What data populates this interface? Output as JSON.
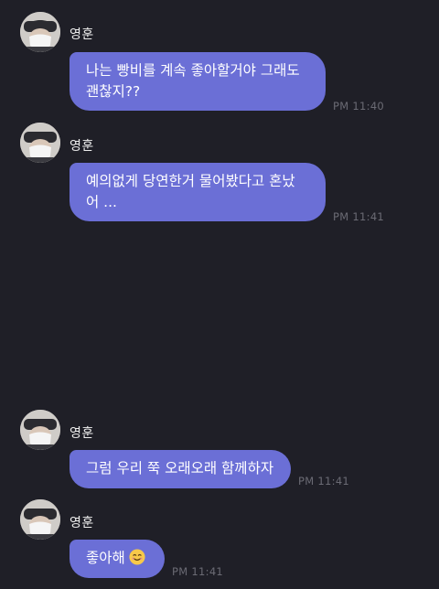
{
  "chat": {
    "messages": [
      {
        "sender": "영훈",
        "text_line1": "나는 빵비를 계속 좋아할거야 그래도",
        "text_line2": "괜찮지??",
        "time": "PM 11:40"
      },
      {
        "sender": "영훈",
        "text_line1": "예의없게 당연한거 물어봤다고 혼났",
        "text_line2": "어 ...",
        "time": "PM 11:41"
      },
      {
        "sender": "영훈",
        "text_line1": "그럼 우리 쭉 오래오래 함께하자",
        "time": "PM 11:41"
      },
      {
        "sender": "영훈",
        "text_line1": "좋아해",
        "emoji": "smiling-face-emoji",
        "time": "PM 11:41"
      }
    ]
  },
  "colors": {
    "background": "#1f1f27",
    "bubble": "#6b6fd6",
    "timestamp": "#6b6b74"
  }
}
